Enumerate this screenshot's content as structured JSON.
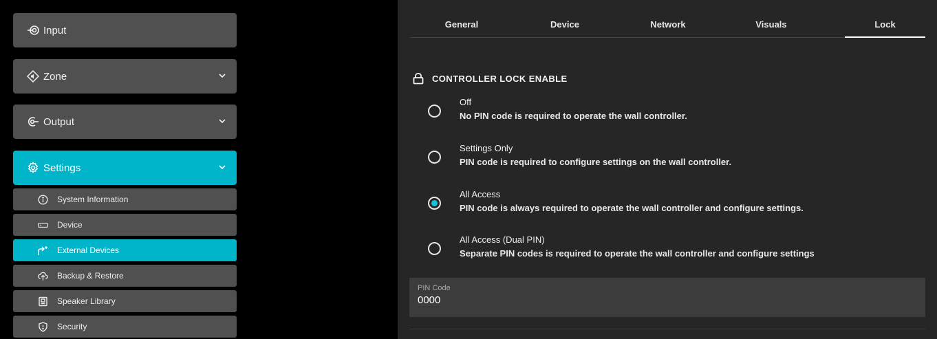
{
  "sidebar": {
    "input_label": "Input",
    "zone_label": "Zone",
    "output_label": "Output",
    "settings_label": "Settings",
    "sub_items": [
      {
        "label": "System Information",
        "icon": "info-circle-icon"
      },
      {
        "label": "Device",
        "icon": "device-icon"
      },
      {
        "label": "External Devices",
        "icon": "external-devices-icon"
      },
      {
        "label": "Backup & Restore",
        "icon": "cloud-upload-icon"
      },
      {
        "label": "Speaker Library",
        "icon": "speaker-icon"
      },
      {
        "label": "Security",
        "icon": "shield-icon"
      }
    ],
    "active_item": "External Devices"
  },
  "tabs": [
    "General",
    "Device",
    "Network",
    "Visuals",
    "Lock"
  ],
  "active_tab": "Lock",
  "lock": {
    "section_title": "CONTROLLER LOCK ENABLE",
    "options": [
      {
        "title": "Off",
        "description": "No PIN code is required to operate the wall controller.",
        "selected": false
      },
      {
        "title": "Settings Only",
        "description": "PIN code is required to configure settings on the wall controller.",
        "selected": false
      },
      {
        "title": "All Access",
        "description": "PIN code is always required to operate the wall controller and configure settings.",
        "selected": true
      },
      {
        "title": "All Access (Dual PIN)",
        "description": "Separate PIN codes is required to operate the wall controller and configure settings",
        "selected": false
      }
    ],
    "pin_label": "PIN Code",
    "pin_value": "0000"
  },
  "colors": {
    "accent": "#00b5c9",
    "nav_background": "#505050",
    "panel_background": "#262626"
  }
}
